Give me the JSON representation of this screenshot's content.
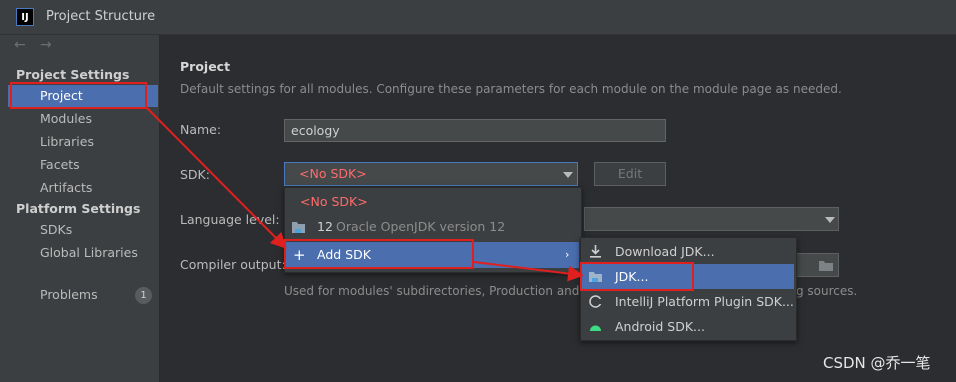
{
  "window": {
    "logo": "IJ",
    "title": "Project Structure"
  },
  "sidebar": {
    "project_settings_heading": "Project Settings",
    "platform_settings_heading": "Platform Settings",
    "items": [
      {
        "label": "Project"
      },
      {
        "label": "Modules"
      },
      {
        "label": "Libraries"
      },
      {
        "label": "Facets"
      },
      {
        "label": "Artifacts"
      },
      {
        "label": "SDKs"
      },
      {
        "label": "Global Libraries"
      },
      {
        "label": "Problems"
      }
    ],
    "problems_count": "1"
  },
  "main": {
    "heading": "Project",
    "description": "Default settings for all modules. Configure these parameters for each module on the module page as needed.",
    "name_label": "Name:",
    "name_value": "ecology",
    "sdk_label": "SDK:",
    "sdk_value": "<No SDK>",
    "edit_button": "Edit",
    "language_level_label": "Language level:",
    "compiler_output_label": "Compiler output:",
    "hint_start": "Used for modules' subdirectories, Production and",
    "hint_end": "g sources."
  },
  "sdk_popup": {
    "no_sdk": "<No SDK>",
    "jdk_version": "12",
    "jdk_name": "Oracle OpenJDK version 12",
    "add_sdk": "Add SDK"
  },
  "add_sdk_submenu": {
    "items": [
      {
        "label": "Download JDK..."
      },
      {
        "label": "JDK..."
      },
      {
        "label": "IntelliJ Platform Plugin SDK..."
      },
      {
        "label": "Android SDK..."
      }
    ]
  },
  "watermark": "CSDN @乔一笔",
  "colors": {
    "selection": "#4b6eaf",
    "annotation_red": "#e0201e",
    "no_sdk_red": "#ff6b6b"
  }
}
